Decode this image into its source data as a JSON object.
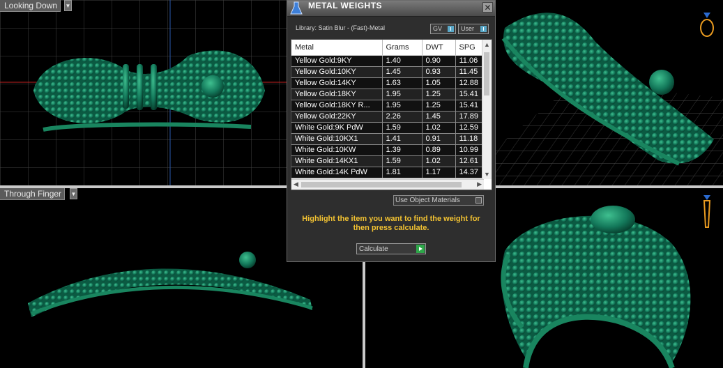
{
  "viewports": {
    "top_left": {
      "label": "Looking Down"
    },
    "bottom_left": {
      "label": "Through Finger"
    }
  },
  "dialog": {
    "title": "METAL WEIGHTS",
    "close_label": "✕",
    "library": "Library: Satin Blur - (Fast)-Metal",
    "toggle_gv": "GV",
    "toggle_user": "User",
    "table": {
      "headers": [
        "Metal",
        "Grams",
        "DWT",
        "SPG"
      ],
      "rows": [
        [
          "Yellow Gold:9KY",
          "1.40",
          "0.90",
          "11.06"
        ],
        [
          "Yellow Gold:10KY",
          "1.45",
          "0.93",
          "11.45"
        ],
        [
          "Yellow Gold:14KY",
          "1.63",
          "1.05",
          "12.88"
        ],
        [
          "Yellow Gold:18KY",
          "1.95",
          "1.25",
          "15.41"
        ],
        [
          "Yellow Gold:18KY R...",
          "1.95",
          "1.25",
          "15.41"
        ],
        [
          "Yellow Gold:22KY",
          "2.26",
          "1.45",
          "17.89"
        ],
        [
          "White Gold:9K PdW",
          "1.59",
          "1.02",
          "12.59"
        ],
        [
          "White Gold:10KX1",
          "1.41",
          "0.91",
          "11.18"
        ],
        [
          "White Gold:10KW",
          "1.39",
          "0.89",
          "10.99"
        ],
        [
          "White Gold:14KX1",
          "1.59",
          "1.02",
          "12.61"
        ],
        [
          "White Gold:14K PdW",
          "1.81",
          "1.17",
          "14.37"
        ]
      ]
    },
    "use_object_materials": "Use Object Materials",
    "hint": "Highlight the item you want to find the weight for then press calculate.",
    "calculate_label": "Calculate"
  },
  "colors": {
    "model_green": "#12775a",
    "grid": "#4d4d4d",
    "hint_text": "#f2c232",
    "accent_blue": "#5aa8c8"
  }
}
